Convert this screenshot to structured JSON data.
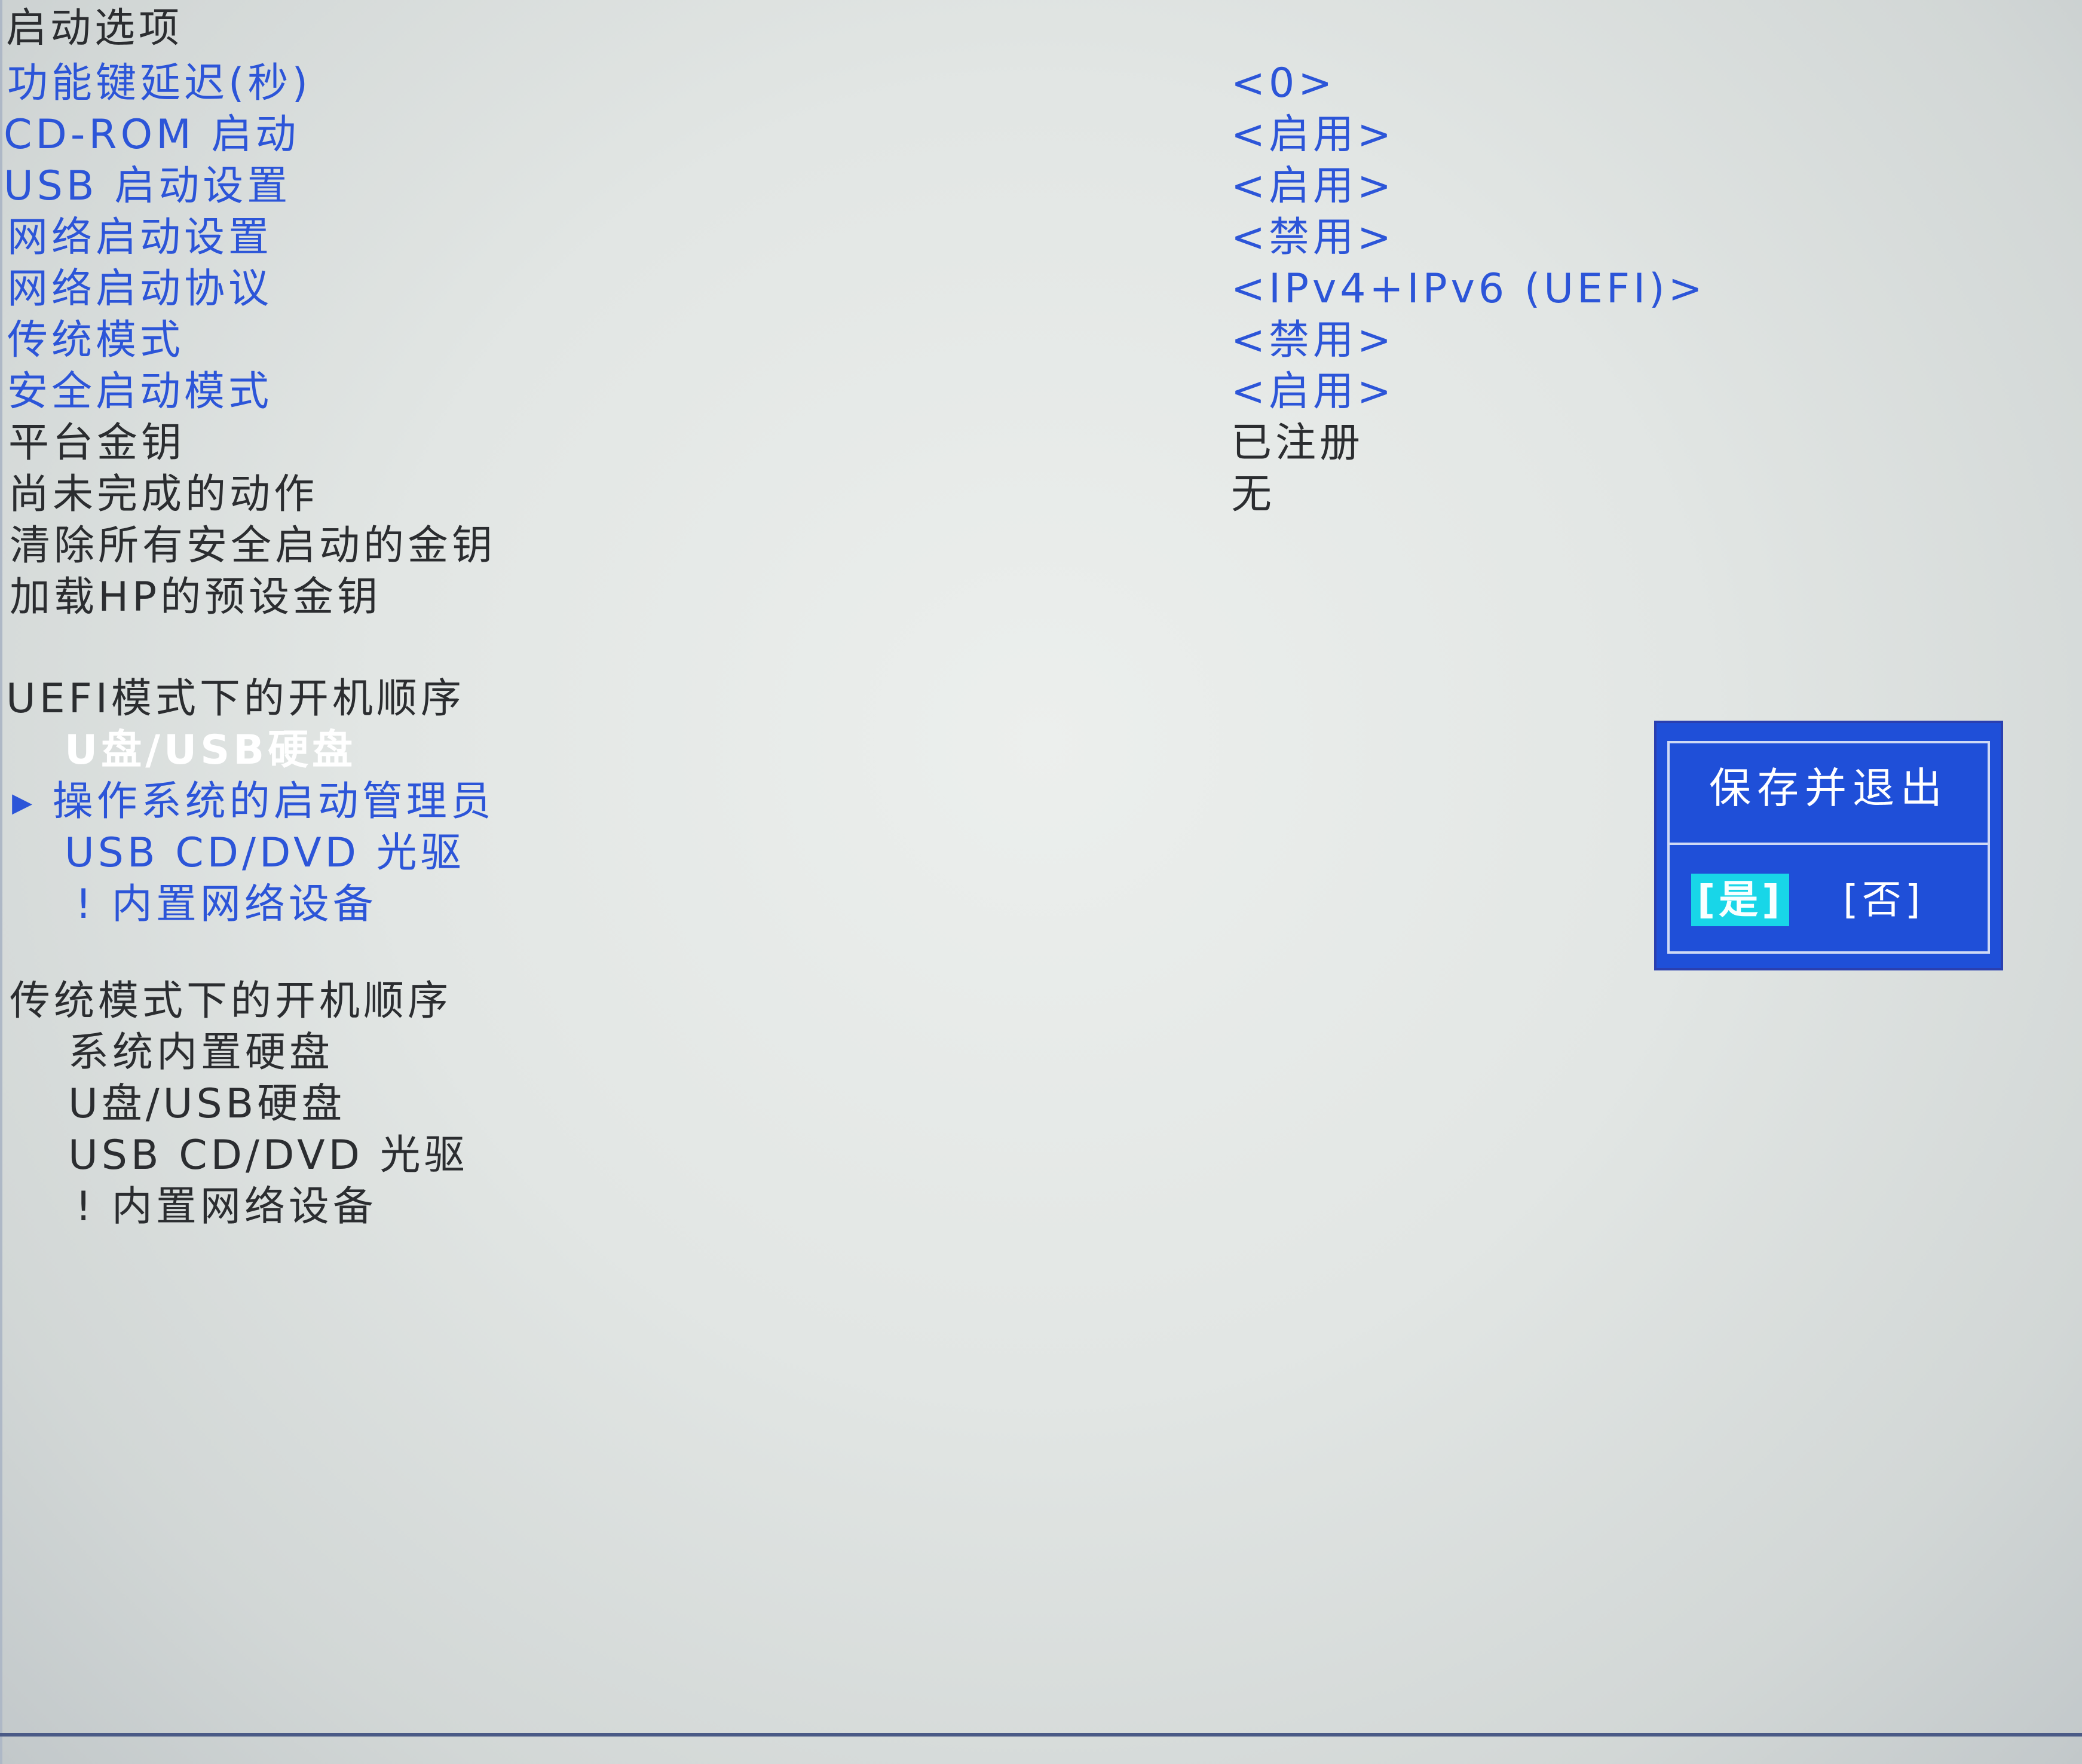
{
  "boot_options": {
    "title": "启动选项",
    "settings": [
      {
        "label": "功能键延迟(秒)",
        "value": "<0>"
      },
      {
        "label": "CD-ROM 启动",
        "value": "<启用>"
      },
      {
        "label": "USB 启动设置",
        "value": "<启用>"
      },
      {
        "label": "网络启动设置",
        "value": "<禁用>"
      },
      {
        "label": "网络启动协议",
        "value": "<IPv4+IPv6 (UEFI)>"
      },
      {
        "label": "传统模式",
        "value": "<禁用>"
      },
      {
        "label": "安全启动模式",
        "value": "<启用>"
      },
      {
        "label": "平台金钥",
        "value": "已注册"
      },
      {
        "label": "尚未完成的动作",
        "value": "无"
      }
    ],
    "actions": [
      "清除所有安全启动的金钥",
      "加载HP的预设金钥"
    ]
  },
  "uefi_order": {
    "title": "UEFI模式下的开机顺序",
    "items": [
      "U盘/USB硬盘",
      "▸ 操作系统的启动管理员",
      "USB CD/DVD 光驱",
      "! 内置网络设备"
    ]
  },
  "legacy_order": {
    "title": "传统模式下的开机顺序",
    "items": [
      "系统内置硬盘",
      "U盘/USB硬盘",
      "USB CD/DVD 光驱",
      "! 内置网络设备"
    ]
  },
  "dialog": {
    "title": "保存并退出",
    "yes": "[是]",
    "no": "[否]"
  },
  "colors": {
    "accent_blue": "#2c55d8",
    "dialog_bg": "#1f4fd8",
    "selected_button": "#18d6e8"
  }
}
